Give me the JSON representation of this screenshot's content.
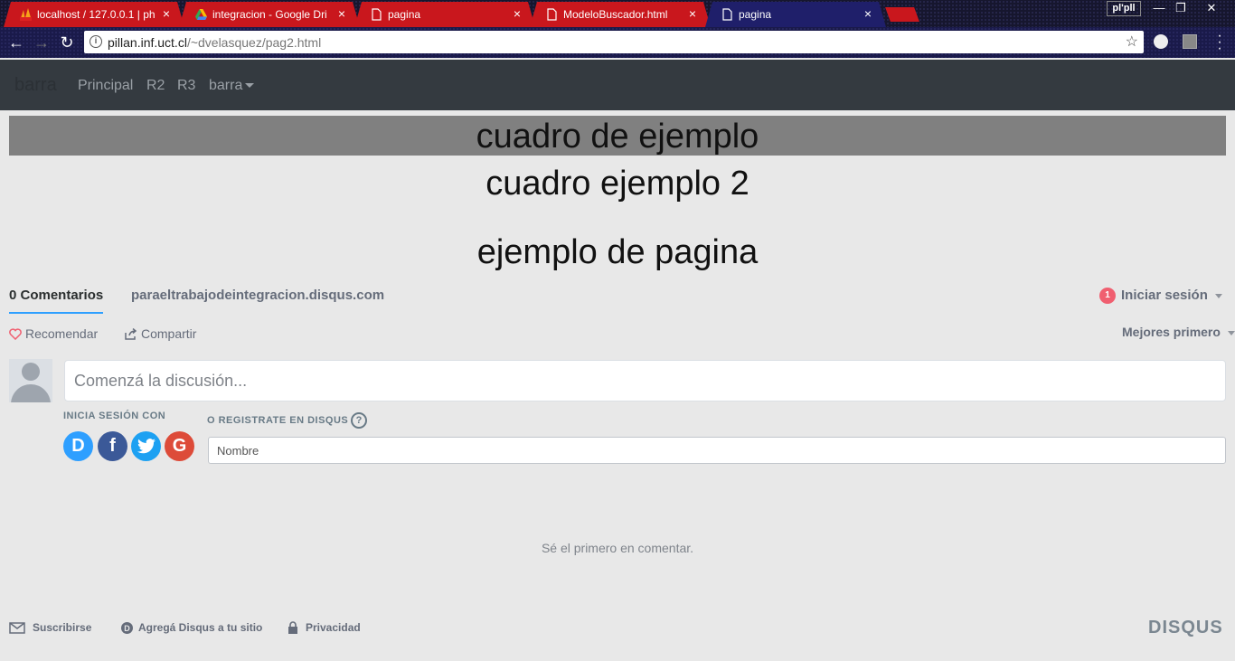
{
  "browser": {
    "tabs": [
      {
        "label": "localhost / 127.0.0.1 | ph",
        "icon": "phpmyadmin-icon"
      },
      {
        "label": "integracion - Google Dri",
        "icon": "google-drive-icon"
      },
      {
        "label": "pagina",
        "icon": "page-icon"
      },
      {
        "label": "ModeloBuscador.html",
        "icon": "page-icon"
      },
      {
        "label": "pagina",
        "icon": "page-icon"
      }
    ],
    "profile": "pl'pll",
    "url_host": "pillan.inf.uct.cl",
    "url_path": "/~dvelasquez/pag2.html"
  },
  "navbar": {
    "brand": "barra",
    "links": [
      "Principal",
      "R2",
      "R3",
      "barra"
    ]
  },
  "content": {
    "box1": "cuadro de ejemplo",
    "box2": "cuadro ejemplo 2",
    "heading": "ejemplo de pagina"
  },
  "disqus": {
    "comments_tab": "0 Comentarios",
    "site": "paraeltrabajodeintegracion.disqus.com",
    "login_badge": "1",
    "login": "Iniciar sesión",
    "recommend": "Recomendar",
    "share": "Compartir",
    "sort": "Mejores primero",
    "textarea_placeholder": "Comenzá la discusión...",
    "login_with": "INICIA SESIÓN CON",
    "register": "O REGISTRATE EN DISQUS",
    "help": "?",
    "social": [
      "D",
      "f",
      "t",
      "G"
    ],
    "name_placeholder": "Nombre",
    "empty": "Sé el primero en comentar.",
    "footer": {
      "subscribe": "Suscribirse",
      "add_disqus": "Agregá Disqus a tu sitio",
      "privacy": "Privacidad",
      "logo": "DISQUS"
    }
  },
  "colors": {
    "tab_red": "#c9171d",
    "navbar": "#343a40",
    "accent": "#2e9fff"
  }
}
